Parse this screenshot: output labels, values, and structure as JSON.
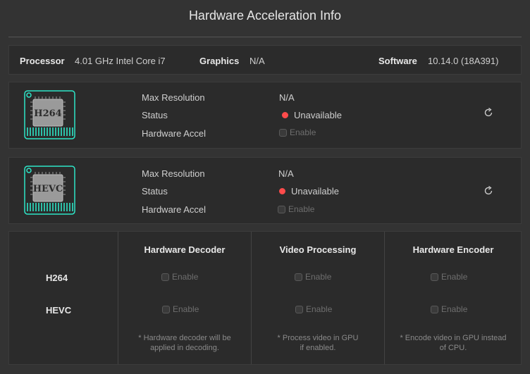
{
  "window": {
    "title": "Hardware Acceleration Info"
  },
  "info": {
    "processor_label": "Processor",
    "processor_value": "4.01 GHz Intel Core i7",
    "graphics_label": "Graphics",
    "graphics_value": "N/A",
    "software_label": "Software",
    "software_value": "10.14.0 (18A391)"
  },
  "cards": [
    {
      "chip_label": "H264",
      "max_res_label": "Max Resolution",
      "max_res_value": "N/A",
      "status_label": "Status",
      "status_value": "Unavailable",
      "hw_accel_label": "Hardware Accel",
      "enable_label": "Enable"
    },
    {
      "chip_label": "HEVC",
      "max_res_label": "Max Resolution",
      "max_res_value": "N/A",
      "status_label": "Status",
      "status_value": "Unavailable",
      "hw_accel_label": "Hardware Accel",
      "enable_label": "Enable"
    }
  ],
  "matrix": {
    "columns": [
      "Hardware Decoder",
      "Video Processing",
      "Hardware Encoder"
    ],
    "rows": [
      "H264",
      "HEVC"
    ],
    "enable_label": "Enable",
    "notes": [
      [
        "* Hardware decoder will be",
        "applied in decoding."
      ],
      [
        "* Process video in GPU",
        "if enabled."
      ],
      [
        "* Encode video in GPU instead",
        "of CPU."
      ]
    ]
  },
  "colors": {
    "accent": "#2ee6c8",
    "status_unavailable": "#ff4b4b"
  }
}
